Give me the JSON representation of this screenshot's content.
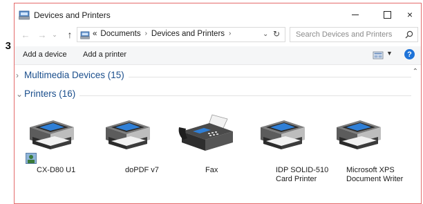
{
  "background_fragment": "3",
  "window": {
    "title": "Devices and Printers",
    "controls": {
      "minimize": "",
      "maximize": "",
      "close": "×"
    }
  },
  "address": {
    "overflow": "«",
    "crumbs": [
      "Documents",
      "Devices and Printers"
    ],
    "search_placeholder": "Search Devices and Printers"
  },
  "commands": {
    "add_device": "Add a device",
    "add_printer": "Add a printer",
    "help": "?"
  },
  "groups": {
    "multimedia": "Multimedia Devices (15)",
    "printers": "Printers (16)"
  },
  "devices": [
    {
      "label": "CX-D80 U1",
      "icon": "printer-icon"
    },
    {
      "label": "doPDF v7",
      "icon": "printer-icon"
    },
    {
      "label": "Fax",
      "icon": "fax-icon"
    },
    {
      "label": "IDP SOLID-510 Card Printer",
      "icon": "printer-icon"
    },
    {
      "label": "Microsoft XPS Document Writer",
      "icon": "printer-icon"
    }
  ],
  "colors": {
    "group_title": "#1a4e8c",
    "window_border": "#e46a6a",
    "help_badge": "#1e73d8"
  }
}
